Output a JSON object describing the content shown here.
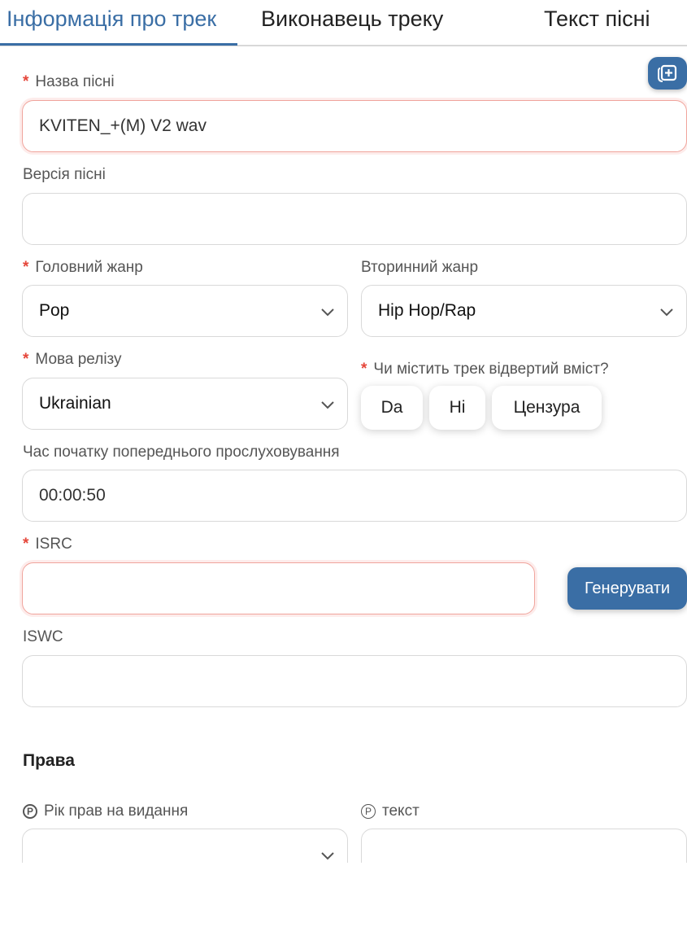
{
  "tabs": [
    {
      "label": "Інформація про трек",
      "active": true
    },
    {
      "label": "Виконавець треку",
      "active": false
    },
    {
      "label": "Текст пісні",
      "active": false
    }
  ],
  "add_button_icon": "add-card-icon",
  "fields": {
    "song_name": {
      "label": "Назва пісні",
      "required": true,
      "value": "KVITEN_+(M) V2 wav"
    },
    "song_version": {
      "label": "Версія пісні",
      "required": false,
      "value": ""
    },
    "primary_genre": {
      "label": "Головний жанр",
      "required": true,
      "value": "Pop"
    },
    "secondary_genre": {
      "label": "Вторинний жанр",
      "required": false,
      "value": "Hip Hop/Rap"
    },
    "release_language": {
      "label": "Мова релізу",
      "required": true,
      "value": "Ukrainian"
    },
    "explicit": {
      "label": "Чи містить трек відвертий вміст?",
      "required": true,
      "options": [
        "Da",
        "Ні",
        "Цензура"
      ]
    },
    "preview_start": {
      "label": "Час початку попереднього прослуховування",
      "required": false,
      "value": "00:00:50"
    },
    "isrc": {
      "label": "ISRC",
      "required": true,
      "value": "",
      "generate_label": "Генерувати"
    },
    "iswc": {
      "label": "ISWC",
      "required": false,
      "value": ""
    }
  },
  "rights": {
    "title": "Права",
    "p_year": {
      "symbol": "P",
      "label": "Рік прав на видання",
      "value": ""
    },
    "p_text": {
      "symbol": "P",
      "label": "текст",
      "value": ""
    }
  },
  "colors": {
    "accent": "#3a6ea5",
    "required": "#e5463a",
    "error_border": "#f0a49c"
  }
}
